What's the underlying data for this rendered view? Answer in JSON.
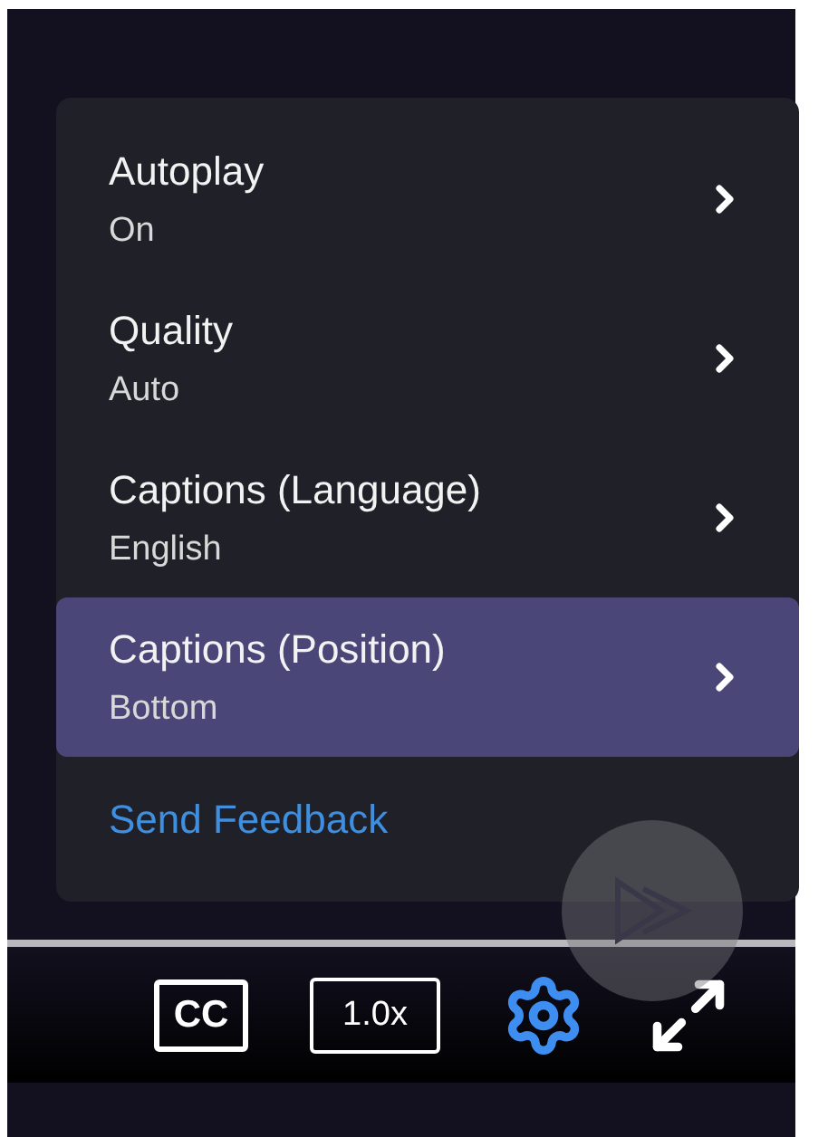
{
  "menu": {
    "items": [
      {
        "title": "Autoplay",
        "value": "On",
        "selected": false
      },
      {
        "title": "Quality",
        "value": "Auto",
        "selected": false
      },
      {
        "title": "Captions (Language)",
        "value": "English",
        "selected": false
      },
      {
        "title": "Captions (Position)",
        "value": "Bottom",
        "selected": true
      }
    ],
    "feedback_link": "Send Feedback"
  },
  "controls": {
    "captions_label": "CC",
    "speed_label": "1.0x"
  }
}
